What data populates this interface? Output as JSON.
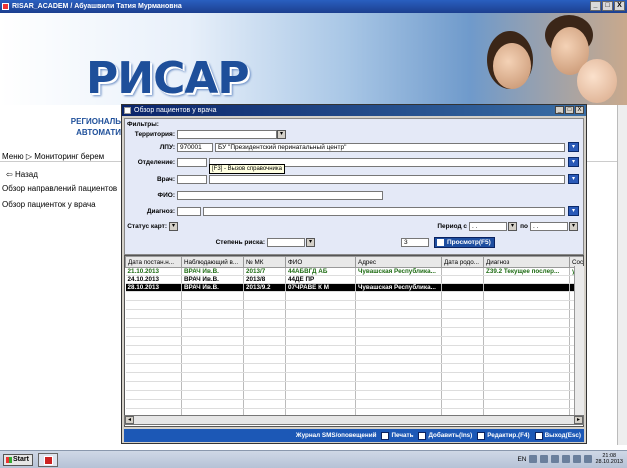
{
  "app": {
    "title": "RISAR_ACADEM / Абуашвили Татия Мурмановна",
    "ctrls": [
      "_",
      "□",
      "X"
    ]
  },
  "banner": {
    "logo": "РИСАР",
    "org_line1": "РЕГИОНАЛЬ",
    "org_line2": "АВТОМАТИ"
  },
  "menu": {
    "breadcrumb": "Меню ▷ Мониторинг берем",
    "back": "Назад",
    "items": [
      "Обзор направлений пациентов",
      "Обзор пациенток у врача"
    ]
  },
  "dialog": {
    "title": "Обзор пациентов у врача",
    "filters_label": "Фильтры:",
    "territory_label": "Территория:",
    "lpu_label": "ЛПУ:",
    "lpu_code": "970001",
    "lpu_name": "БУ \"Президентский перинатальный центр\"",
    "department_label": "Отделение:",
    "doctor_label": "Врач:",
    "fio_label": "ФИО:",
    "diagnosis_label": "Диагноз:",
    "card_status_label": "Статус карт:",
    "risk_label": "Степень риска:",
    "period_label": "Период с",
    "period_from": ". .",
    "period_to_label": "по",
    "period_to": ". .",
    "count_value": "3",
    "view_button": "Просмотр(F5)",
    "tooltip": "[F3] - Вызов справочника"
  },
  "table": {
    "columns": [
      "Дата постан.н...",
      "Наблюдающий в...",
      "№ МК",
      "ФИО",
      "Адрес",
      "Дата родо...",
      "Диагноз",
      "Сос"
    ],
    "rows": [
      {
        "style": "green",
        "cells": [
          "21.10.2013",
          "ВРАЧ Ив.В.",
          "2013/7",
          "44АБВГД АБ",
          "Чувашская Республика...",
          "",
          "Z39.2 Текущее послер...",
          "удо"
        ]
      },
      {
        "style": "black",
        "cells": [
          "24.10.2013",
          "ВРАЧ Ив.В.",
          "2013/8",
          "44ДЕ ПР",
          "",
          "",
          "",
          ""
        ]
      },
      {
        "style": "selected",
        "cells": [
          "28.10.2013",
          "ВРАЧ Ив.В.",
          "2013/9.2",
          "07ЧРАВЕ К М",
          "Чувашская Республика...",
          "",
          "",
          ""
        ]
      }
    ]
  },
  "bottom_buttons": [
    "Журнал SMS/оповещений",
    "Печать",
    "Добавить(Ins)",
    "Редактир.(F4)",
    "Выход(Esc)"
  ],
  "taskbar": {
    "start": "Start",
    "lang": "EN",
    "time": "21:08",
    "date": "28.10.2013"
  }
}
